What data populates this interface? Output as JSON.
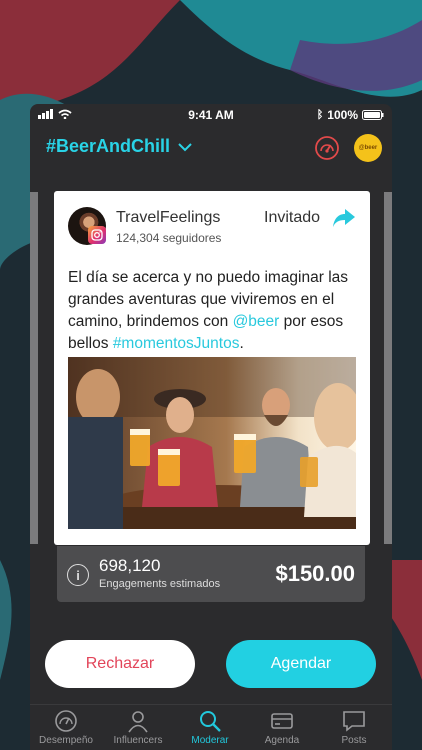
{
  "status_bar": {
    "time": "9:41 AM",
    "battery": "100%"
  },
  "header": {
    "campaign": "#BeerAndChill",
    "brand_logo_text": "@beer"
  },
  "post": {
    "influencer_name": "TravelFeelings",
    "followers": "124,304 seguidores",
    "status": "Invitado",
    "text_before": "El día se acerca y no puedo imaginar las grandes aventuras que viviremos en el camino, brindemos con ",
    "mention": "@beer",
    "text_middle": " por esos bellos ",
    "hashtag": "#momentosJuntos",
    "text_after": "."
  },
  "stats": {
    "engagements": "698,120",
    "engagements_label": "Engagements estimados",
    "price": "$150.00"
  },
  "actions": {
    "reject": "Rechazar",
    "schedule": "Agendar"
  },
  "tabs": [
    {
      "label": "Desempeño",
      "icon": "gauge-icon"
    },
    {
      "label": "Influencers",
      "icon": "person-icon"
    },
    {
      "label": "Moderar",
      "icon": "search-icon",
      "active": true
    },
    {
      "label": "Agenda",
      "icon": "card-icon"
    },
    {
      "label": "Posts",
      "icon": "chat-icon"
    }
  ],
  "colors": {
    "accent": "#22d0e2",
    "reject": "#e2455a",
    "gauge": "#e24a4a"
  }
}
